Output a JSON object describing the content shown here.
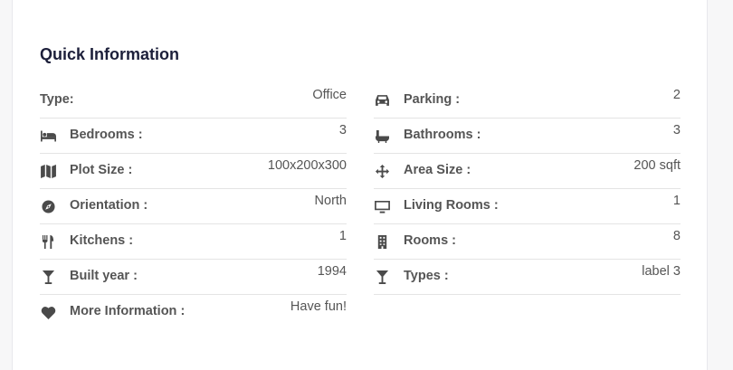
{
  "section": {
    "title": "Quick Information"
  },
  "left": [
    {
      "icon": "none",
      "label": "Type:",
      "value": "Office"
    },
    {
      "icon": "bed-icon",
      "label": "Bedrooms :",
      "value": "3"
    },
    {
      "icon": "map-icon",
      "label": "Plot Size :",
      "value": "100x200x300"
    },
    {
      "icon": "compass-icon",
      "label": "Orientation :",
      "value": "North"
    },
    {
      "icon": "utensils-icon",
      "label": "Kitchens :",
      "value": "1"
    },
    {
      "icon": "glass-icon",
      "label": "Built year :",
      "value": "1994"
    },
    {
      "icon": "heart-icon",
      "label": "More Information :",
      "value": "Have fun!"
    }
  ],
  "right": [
    {
      "icon": "car-icon",
      "label": "Parking :",
      "value": "2"
    },
    {
      "icon": "bath-icon",
      "label": "Bathrooms :",
      "value": "3"
    },
    {
      "icon": "arrows-icon",
      "label": "Area Size :",
      "value": "200 sqft"
    },
    {
      "icon": "monitor-icon",
      "label": "Living Rooms :",
      "value": "1"
    },
    {
      "icon": "building-icon",
      "label": "Rooms :",
      "value": "8"
    },
    {
      "icon": "glass-icon",
      "label": "Types :",
      "value": "label 3"
    }
  ]
}
